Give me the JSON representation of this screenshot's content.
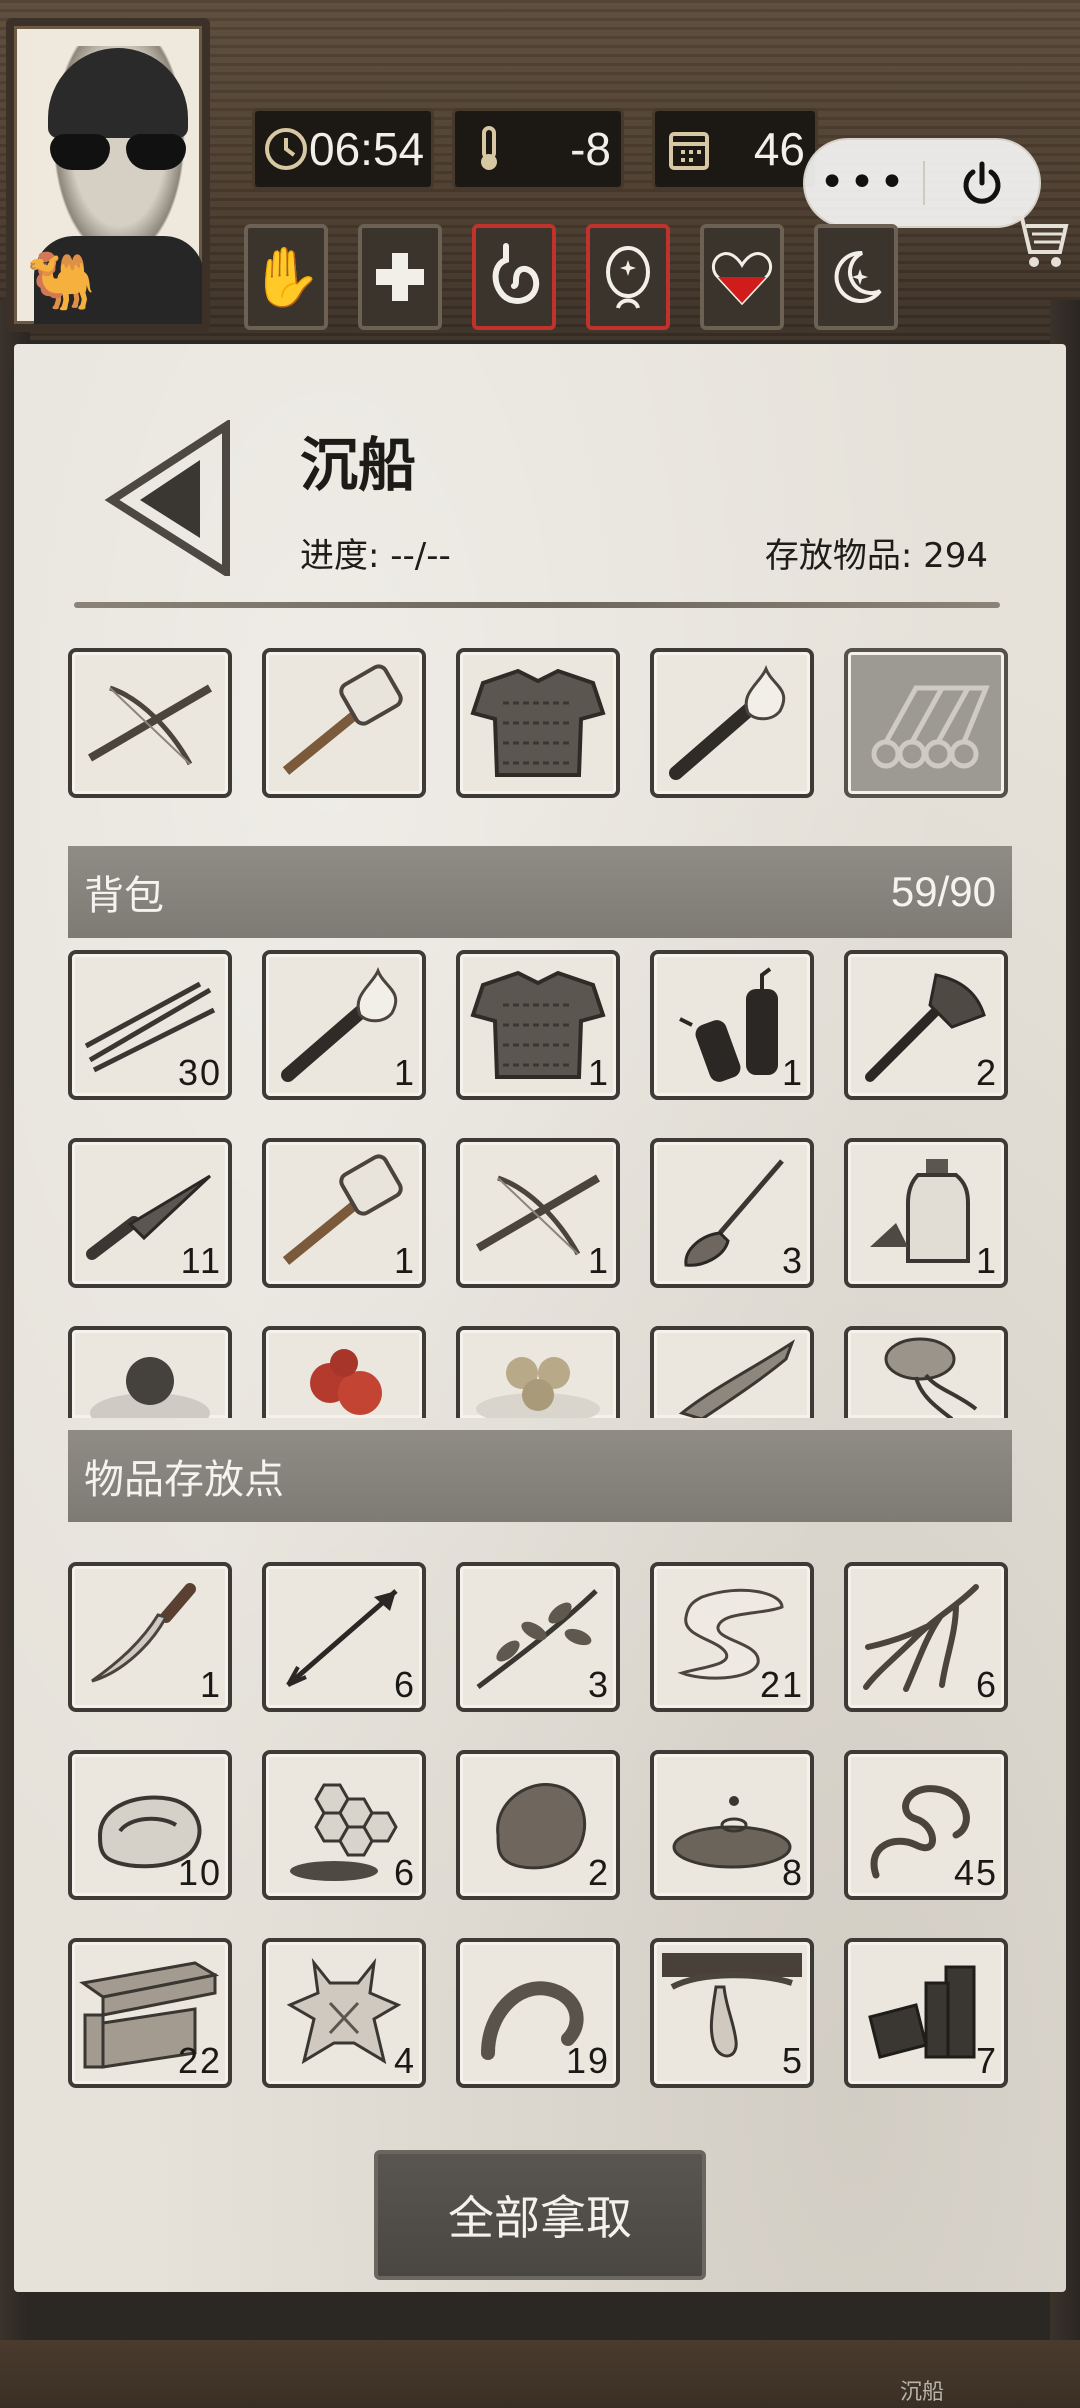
{
  "status_bar": {
    "time": "06:54",
    "temperature": "-8",
    "days": "46"
  },
  "status_icons": [
    "clock-icon",
    "thermometer-icon",
    "calendar-icon"
  ],
  "conditions": [
    {
      "name": "bandaged-hand-icon",
      "alert": false
    },
    {
      "name": "health-cross-icon",
      "alert": false
    },
    {
      "name": "stomach-icon",
      "alert": true
    },
    {
      "name": "mind-icon",
      "alert": true
    },
    {
      "name": "heart-icon",
      "alert": false
    },
    {
      "name": "moon-star-icon",
      "alert": false
    }
  ],
  "menu": {
    "more": "•••"
  },
  "location": {
    "title": "沉船",
    "progress": "进度: --/--",
    "stored": "存放物品: 294"
  },
  "equipped": [
    {
      "item": "crossbow-icon"
    },
    {
      "item": "hammer-icon"
    },
    {
      "item": "armor-icon"
    },
    {
      "item": "torch-icon"
    },
    {
      "item": "logs-icon",
      "disabled": true
    }
  ],
  "backpack": {
    "label": "背包",
    "capacity": "59/90",
    "rows": [
      [
        {
          "item": "arrows-icon",
          "count": "30"
        },
        {
          "item": "torch-icon",
          "count": "1"
        },
        {
          "item": "armor-icon",
          "count": "1"
        },
        {
          "item": "dynamite-icon",
          "count": "1"
        },
        {
          "item": "axe-icon",
          "count": "2"
        }
      ],
      [
        {
          "item": "kunai-icon",
          "count": "11"
        },
        {
          "item": "hammer-icon",
          "count": "1"
        },
        {
          "item": "crossbow-icon",
          "count": "1"
        },
        {
          "item": "broom-icon",
          "count": "3"
        },
        {
          "item": "potion-bottle-icon",
          "count": "1"
        }
      ],
      [
        {
          "item": "stone-ball-icon",
          "count": ""
        },
        {
          "item": "berries-icon",
          "count": ""
        },
        {
          "item": "dumplings-icon",
          "count": ""
        },
        {
          "item": "fish-icon",
          "count": ""
        },
        {
          "item": "squid-icon",
          "count": ""
        }
      ]
    ]
  },
  "storage": {
    "label": "物品存放点",
    "rows": [
      [
        {
          "item": "dagger-icon",
          "count": "1"
        },
        {
          "item": "arrow-icon",
          "count": "6"
        },
        {
          "item": "herb-branch-icon",
          "count": "3"
        },
        {
          "item": "cloth-icon",
          "count": "21"
        },
        {
          "item": "root-icon",
          "count": "6"
        }
      ],
      [
        {
          "item": "meat-icon",
          "count": "10"
        },
        {
          "item": "honeycomb-icon",
          "count": "6"
        },
        {
          "item": "clay-icon",
          "count": "2"
        },
        {
          "item": "puddle-icon",
          "count": "8"
        },
        {
          "item": "vine-icon",
          "count": "45"
        }
      ],
      [
        {
          "item": "planks-icon",
          "count": "22"
        },
        {
          "item": "hide-icon",
          "count": "4"
        },
        {
          "item": "worm-icon",
          "count": "19"
        },
        {
          "item": "resin-icon",
          "count": "5"
        },
        {
          "item": "charcoal-icon",
          "count": "7"
        }
      ]
    ]
  },
  "actions": {
    "take_all": "全部拿取"
  },
  "watermark": "沉船"
}
